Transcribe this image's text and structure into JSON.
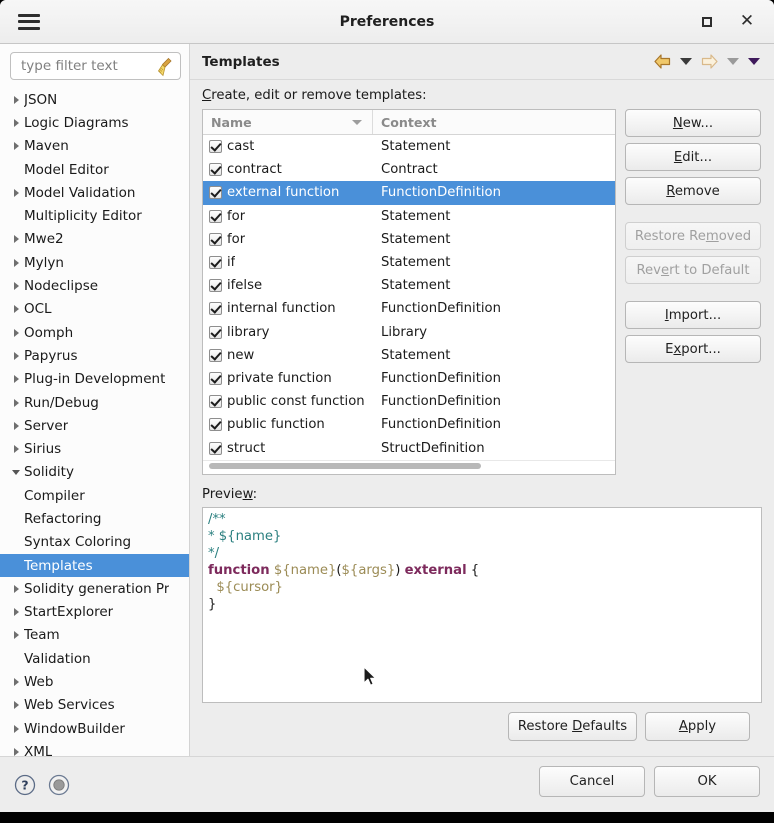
{
  "window": {
    "title": "Preferences",
    "menu_icon": "hamburger-icon",
    "maximize_icon": "maximize-icon",
    "close_icon": "close-icon"
  },
  "sidebar": {
    "filter": {
      "value": "",
      "placeholder": "type filter text",
      "clear_icon": "broom-icon"
    },
    "items": [
      {
        "label": "JSON",
        "level": 1,
        "expandable": true,
        "expanded": false,
        "selected": false
      },
      {
        "label": "Logic Diagrams",
        "level": 1,
        "expandable": true,
        "expanded": false,
        "selected": false
      },
      {
        "label": "Maven",
        "level": 1,
        "expandable": true,
        "expanded": false,
        "selected": false
      },
      {
        "label": "Model Editor",
        "level": 1,
        "expandable": false,
        "expanded": false,
        "selected": false
      },
      {
        "label": "Model Validation",
        "level": 1,
        "expandable": true,
        "expanded": false,
        "selected": false
      },
      {
        "label": "Multiplicity Editor",
        "level": 1,
        "expandable": false,
        "expanded": false,
        "selected": false
      },
      {
        "label": "Mwe2",
        "level": 1,
        "expandable": true,
        "expanded": false,
        "selected": false
      },
      {
        "label": "Mylyn",
        "level": 1,
        "expandable": true,
        "expanded": false,
        "selected": false
      },
      {
        "label": "Nodeclipse",
        "level": 1,
        "expandable": true,
        "expanded": false,
        "selected": false
      },
      {
        "label": "OCL",
        "level": 1,
        "expandable": true,
        "expanded": false,
        "selected": false
      },
      {
        "label": "Oomph",
        "level": 1,
        "expandable": true,
        "expanded": false,
        "selected": false
      },
      {
        "label": "Papyrus",
        "level": 1,
        "expandable": true,
        "expanded": false,
        "selected": false
      },
      {
        "label": "Plug-in Development",
        "level": 1,
        "expandable": true,
        "expanded": false,
        "selected": false
      },
      {
        "label": "Run/Debug",
        "level": 1,
        "expandable": true,
        "expanded": false,
        "selected": false
      },
      {
        "label": "Server",
        "level": 1,
        "expandable": true,
        "expanded": false,
        "selected": false
      },
      {
        "label": "Sirius",
        "level": 1,
        "expandable": true,
        "expanded": false,
        "selected": false
      },
      {
        "label": "Solidity",
        "level": 1,
        "expandable": true,
        "expanded": true,
        "selected": false
      },
      {
        "label": "Compiler",
        "level": 2,
        "expandable": false,
        "expanded": false,
        "selected": false
      },
      {
        "label": "Refactoring",
        "level": 2,
        "expandable": false,
        "expanded": false,
        "selected": false
      },
      {
        "label": "Syntax Coloring",
        "level": 2,
        "expandable": false,
        "expanded": false,
        "selected": false
      },
      {
        "label": "Templates",
        "level": 2,
        "expandable": false,
        "expanded": false,
        "selected": true
      },
      {
        "label": "Solidity generation Pr",
        "level": 1,
        "expandable": true,
        "expanded": false,
        "selected": false
      },
      {
        "label": "StartExplorer",
        "level": 1,
        "expandable": true,
        "expanded": false,
        "selected": false
      },
      {
        "label": "Team",
        "level": 1,
        "expandable": true,
        "expanded": false,
        "selected": false
      },
      {
        "label": "Validation",
        "level": 1,
        "expandable": false,
        "expanded": false,
        "selected": false
      },
      {
        "label": "Web",
        "level": 1,
        "expandable": true,
        "expanded": false,
        "selected": false
      },
      {
        "label": "Web Services",
        "level": 1,
        "expandable": true,
        "expanded": false,
        "selected": false
      },
      {
        "label": "WindowBuilder",
        "level": 1,
        "expandable": true,
        "expanded": false,
        "selected": false
      },
      {
        "label": "XML",
        "level": 1,
        "expandable": true,
        "expanded": false,
        "selected": false
      }
    ]
  },
  "main": {
    "heading": "Templates",
    "nav": {
      "back_icon": "back-arrow-icon",
      "back_menu_icon": "chevron-down-icon",
      "forward_icon": "forward-arrow-icon",
      "forward_menu_icon": "chevron-down-icon",
      "view_menu_icon": "chevron-down-icon"
    },
    "section_label_prefix": "C",
    "section_label_rest": "reate, edit or remove templates:",
    "table": {
      "columns": [
        "Name",
        "Context"
      ],
      "sort_indicator": "sort-descending-icon",
      "rows": [
        {
          "checked": true,
          "name": "cast",
          "context": "Statement",
          "selected": false
        },
        {
          "checked": true,
          "name": "contract",
          "context": "Contract",
          "selected": false
        },
        {
          "checked": true,
          "name": "external function",
          "context": "FunctionDefinition",
          "selected": true
        },
        {
          "checked": true,
          "name": "for",
          "context": "Statement",
          "selected": false
        },
        {
          "checked": true,
          "name": "for",
          "context": "Statement",
          "selected": false
        },
        {
          "checked": true,
          "name": "if",
          "context": "Statement",
          "selected": false
        },
        {
          "checked": true,
          "name": "ifelse",
          "context": "Statement",
          "selected": false
        },
        {
          "checked": true,
          "name": "internal function",
          "context": "FunctionDefinition",
          "selected": false
        },
        {
          "checked": true,
          "name": "library",
          "context": "Library",
          "selected": false
        },
        {
          "checked": true,
          "name": "new",
          "context": "Statement",
          "selected": false
        },
        {
          "checked": true,
          "name": "private function",
          "context": "FunctionDefinition",
          "selected": false
        },
        {
          "checked": true,
          "name": "public const function",
          "context": "FunctionDefinition",
          "selected": false
        },
        {
          "checked": true,
          "name": "public function",
          "context": "FunctionDefinition",
          "selected": false
        },
        {
          "checked": true,
          "name": "struct",
          "context": "StructDefinition",
          "selected": false
        }
      ]
    },
    "buttons": [
      {
        "label": "New...",
        "mnemonic_index": 0,
        "enabled": true,
        "gap_above": false
      },
      {
        "label": "Edit...",
        "mnemonic_index": 0,
        "enabled": true,
        "gap_above": false
      },
      {
        "label": "Remove",
        "mnemonic_index": 0,
        "enabled": true,
        "gap_above": false
      },
      {
        "label": "Restore Removed",
        "mnemonic_index": 10,
        "enabled": false,
        "gap_above": true
      },
      {
        "label": "Revert to Default",
        "mnemonic_index": 3,
        "enabled": false,
        "gap_above": false
      },
      {
        "label": "Import...",
        "mnemonic_index": 0,
        "enabled": true,
        "gap_above": true
      },
      {
        "label": "Export...",
        "mnemonic_index": 1,
        "enabled": true,
        "gap_above": false
      }
    ],
    "preview": {
      "label_prefix": "Previe",
      "label_mnemonic": "w",
      "label_suffix": ":",
      "code_lines": [
        [
          {
            "t": "/**",
            "c": "comment"
          }
        ],
        [
          {
            "t": "* ",
            "c": "comment"
          },
          {
            "t": "${name}",
            "c": "comment"
          }
        ],
        [
          {
            "t": "*/",
            "c": "comment"
          }
        ],
        [
          {
            "t": "function",
            "c": "keyword"
          },
          {
            "t": " ",
            "c": "punct"
          },
          {
            "t": "${name}",
            "c": "var"
          },
          {
            "t": "(",
            "c": "punct"
          },
          {
            "t": "${args}",
            "c": "var"
          },
          {
            "t": ")",
            "c": "punct"
          },
          {
            "t": " ",
            "c": "punct"
          },
          {
            "t": "external",
            "c": "keyword"
          },
          {
            "t": " {",
            "c": "punct"
          }
        ],
        [
          {
            "t": "  ",
            "c": "punct"
          },
          {
            "t": "${cursor}",
            "c": "var"
          }
        ],
        [
          {
            "t": "}",
            "c": "punct"
          }
        ]
      ],
      "cursor_icon": "mouse-pointer-icon"
    },
    "restore_defaults": {
      "prefix": "Restore ",
      "mnemonic": "D",
      "suffix": "efaults"
    },
    "apply": {
      "prefix": "",
      "mnemonic": "A",
      "suffix": "pply"
    }
  },
  "footer": {
    "help_icon": "help-icon",
    "status_icon": "status-circle-icon",
    "cancel_label": "Cancel",
    "ok_label": "OK"
  },
  "colors": {
    "selection": "#4a90d9",
    "window_bg": "#ededed",
    "comment": "#2a7f7f",
    "keyword": "#7d2a5c",
    "variable": "#9b8b55"
  }
}
